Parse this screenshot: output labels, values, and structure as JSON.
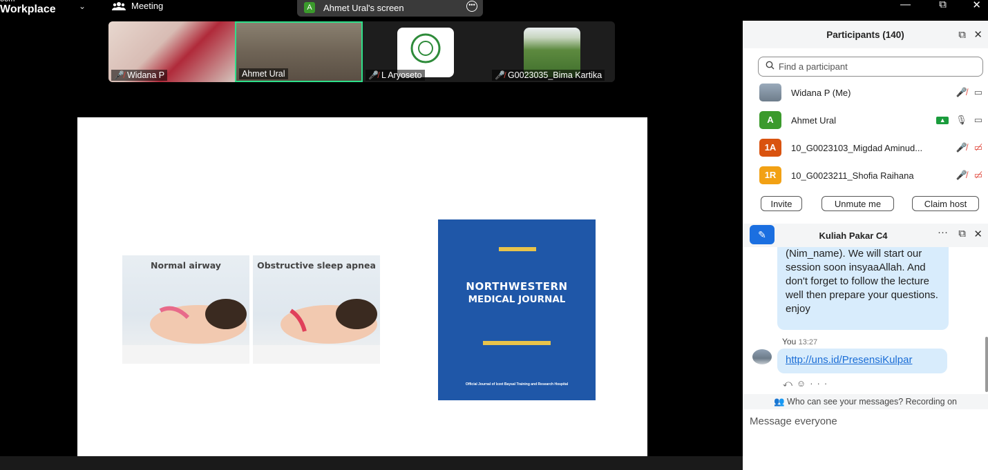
{
  "brand": {
    "line1": "oom",
    "line2": "Workplace"
  },
  "topbar": {
    "meeting_label": "Meeting",
    "share_avatar": "A",
    "share_label": "Ahmet Ural's screen"
  },
  "window_controls": {
    "minimize": "—",
    "restore": "⧉",
    "close": "✕"
  },
  "thumbnails": [
    {
      "name": "Widana P",
      "muted": true
    },
    {
      "name": "Ahmet Ural",
      "muted": false,
      "active_speaker": true
    },
    {
      "name": "L Aryoseto",
      "muted": true
    },
    {
      "name": "G0023035_Bima Kartika",
      "muted": true
    }
  ],
  "slide": {
    "airway_left_caption": "Normal airway",
    "airway_right_caption": "Obstructive sleep apnea",
    "journal_line1": "NORTHWESTERN",
    "journal_line2": "MEDICAL JOURNAL",
    "journal_footer": "Official Journal of Izzet Baysal Training and Research Hospital"
  },
  "participants": {
    "header": "Participants (140)",
    "search_placeholder": "Find a participant",
    "list": [
      {
        "avatar": "",
        "avatar_color": "#7a8a9a",
        "name": "Widana P (Me)"
      },
      {
        "avatar": "A",
        "avatar_color": "#3b9a2c",
        "name": "Ahmet Ural"
      },
      {
        "avatar": "1A",
        "avatar_color": "#d9530f",
        "name": "10_G0023103_Migdad Aminud..."
      },
      {
        "avatar": "1R",
        "avatar_color": "#f2a114",
        "name": "10_G0023211_Shofia Raihana"
      }
    ],
    "buttons": {
      "invite": "Invite",
      "unmute": "Unmute me",
      "claim": "Claim host"
    }
  },
  "chat": {
    "title": "Kuliah Pakar C4",
    "message1": "(Nim_name). We will start our session soon insyaaAllah. And don't forget to follow the lecture well then prepare your questions. enjoy",
    "sender": "You",
    "time": "13:27",
    "link": "http://uns.id/PresensiKulpar",
    "visibility_note": "Who can see your messages? Recording on",
    "input_placeholder": "Message everyone"
  }
}
